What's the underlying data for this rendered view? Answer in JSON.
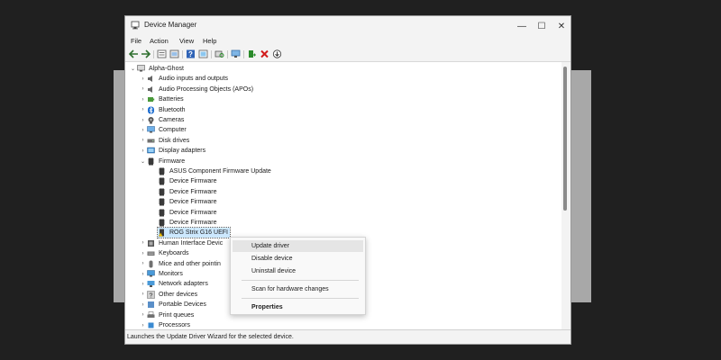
{
  "window": {
    "title": "Device Manager",
    "controls": {
      "minimize": "—",
      "maximize": "☐",
      "close": "✕"
    }
  },
  "menu": [
    "File",
    "Action",
    "View",
    "Help"
  ],
  "toolbar_icons": [
    "back-icon",
    "forward-icon",
    "properties-icon",
    "driver-details-icon",
    "help-icon",
    "update-icon",
    "scan-icon",
    "monitor-icon",
    "add-driver-icon",
    "uninstall-icon",
    "download-icon"
  ],
  "tree": {
    "root": "Alpha-Ghost",
    "categories": [
      "Audio inputs and outputs",
      "Audio Processing Objects (APOs)",
      "Batteries",
      "Bluetooth",
      "Cameras",
      "Computer",
      "Disk drives",
      "Display adapters",
      "Firmware"
    ],
    "firmware_children": [
      "ASUS Component Firmware Update",
      "Device Firmware",
      "Device Firmware",
      "Device Firmware",
      "Device Firmware",
      "Device Firmware",
      "ROG Strix G16 UEFI"
    ],
    "categories_after": [
      "Human Interface Devic",
      "Keyboards",
      "Mice and other pointin",
      "Monitors",
      "Network adapters",
      "Other devices",
      "Portable Devices",
      "Print queues",
      "Processors"
    ]
  },
  "context_menu": {
    "items": [
      "Update driver",
      "Disable device",
      "Uninstall device",
      "Scan for hardware changes",
      "Properties"
    ]
  },
  "status": "Launches the Update Driver Wizard for the selected device."
}
